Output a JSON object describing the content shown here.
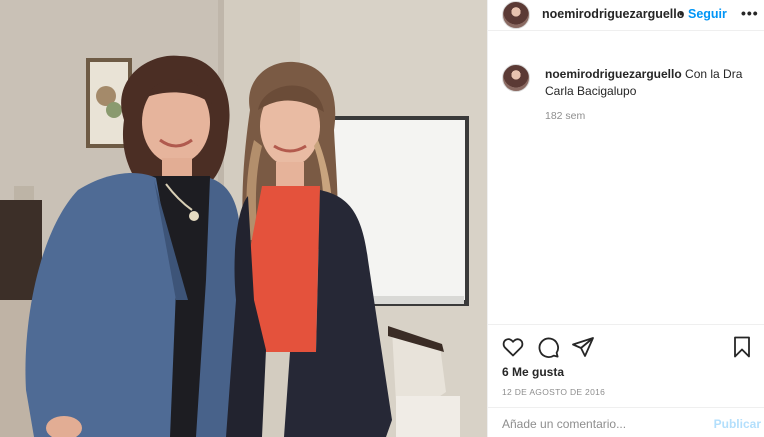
{
  "post": {
    "username": "noemirodriguezarguello",
    "separator": "•",
    "follow_label": "Seguir",
    "more_label": "•••",
    "caption_user": "noemirodriguezarguello",
    "caption_text": "Con la Dra Carla Bacigalupo",
    "caption_time": "182 sem",
    "likes": "6 Me gusta",
    "date": "12 DE AGOSTO DE 2016",
    "comment_placeholder": "Añade un comentario...",
    "publish_label": "Publicar"
  },
  "icons": {
    "like": "heart-icon",
    "comment": "comment-bubble-icon",
    "share": "paper-plane-icon",
    "save": "bookmark-icon",
    "more": "more-options-icon"
  },
  "colors": {
    "link": "#0095f6",
    "publish_disabled": "#b3dffc",
    "muted": "#8e8e8e",
    "text": "#262626"
  }
}
